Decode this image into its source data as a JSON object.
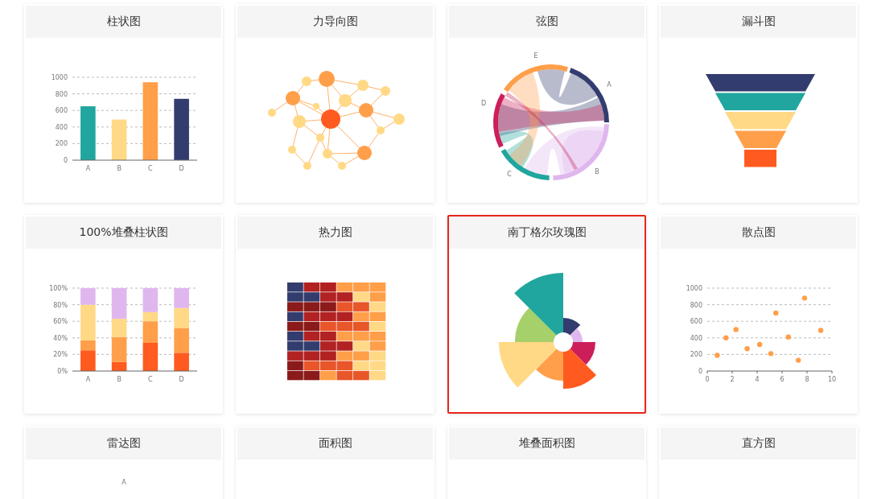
{
  "cards": [
    {
      "title": "柱状图",
      "selected": false,
      "chart_data": {
        "type": "bar",
        "stacked": true,
        "grid": true,
        "categories": [
          "A",
          "B",
          "C",
          "D"
        ],
        "ylim": [
          0,
          1000
        ],
        "yticks": [
          0,
          200,
          400,
          600,
          800,
          1000
        ],
        "series": [
          {
            "color": "#20a69e",
            "values": [
              650,
              null,
              null,
              null
            ]
          },
          {
            "color": "#ffd985",
            "values": [
              null,
              490,
              null,
              null
            ]
          },
          {
            "color": "#ff9f4a",
            "values": [
              null,
              null,
              940,
              null
            ]
          },
          {
            "color": "#333c6e",
            "values": [
              null,
              null,
              null,
              740
            ]
          }
        ]
      }
    },
    {
      "title": "力导向图",
      "selected": false,
      "kind": "force"
    },
    {
      "title": "弦图",
      "selected": false,
      "kind": "chord",
      "labels": [
        "E",
        "A",
        "D",
        "C",
        "B"
      ]
    },
    {
      "title": "漏斗图",
      "selected": false,
      "kind": "funnel"
    },
    {
      "title": "100%堆叠柱状图",
      "selected": false,
      "chart_data": {
        "type": "bar",
        "stacked": true,
        "grid": true,
        "categories": [
          "A",
          "B",
          "C",
          "D"
        ],
        "ylim": [
          0,
          100
        ],
        "yticks": [
          {
            "value": 0,
            "label": "0%"
          },
          {
            "value": 20,
            "label": "20%"
          },
          {
            "value": 40,
            "label": "40%"
          },
          {
            "value": 60,
            "label": "60%"
          },
          {
            "value": 80,
            "label": "80%"
          },
          {
            "value": 100,
            "label": "100%"
          }
        ],
        "series": [
          {
            "color": "#ff5a1f",
            "values": [
              25,
              11,
              34,
              22
            ]
          },
          {
            "color": "#ff9f4a",
            "values": [
              12,
              30,
              26,
              30
            ]
          },
          {
            "color": "#ffd985",
            "values": [
              43,
              22,
              11,
              24
            ]
          },
          {
            "color": "#dfb7ee",
            "values": [
              20,
              37,
              29,
              24
            ]
          }
        ]
      }
    },
    {
      "title": "热力图",
      "selected": false,
      "kind": "heatmap"
    },
    {
      "title": "南丁格尔玫瑰图",
      "selected": true,
      "kind": "rose"
    },
    {
      "title": "散点图",
      "selected": false,
      "chart_data": {
        "type": "scatter",
        "grid": true,
        "x": [
          0.8,
          1.5,
          2.3,
          3.2,
          4.2,
          5.1,
          5.5,
          6.5,
          7.3,
          7.8,
          9.1
        ],
        "xlim": [
          0,
          10
        ],
        "ylim": [
          0,
          1000
        ],
        "xticks": [
          0,
          2,
          4,
          6,
          8,
          10
        ],
        "yticks": [
          0,
          200,
          400,
          600,
          800,
          1000
        ],
        "series": [
          {
            "color": "#ff9f4a",
            "values": [
              190,
              400,
              500,
              270,
              320,
              210,
              700,
              410,
              130,
              880,
              490
            ]
          }
        ]
      }
    },
    {
      "title": "雷达图",
      "selected": false,
      "kind": "radar",
      "labels": [
        "A"
      ]
    },
    {
      "title": "面积图",
      "selected": false,
      "kind": "area"
    },
    {
      "title": "堆叠面积图",
      "selected": false,
      "kind": "stacked-area"
    },
    {
      "title": "直方图",
      "selected": false,
      "kind": "histogram"
    }
  ]
}
